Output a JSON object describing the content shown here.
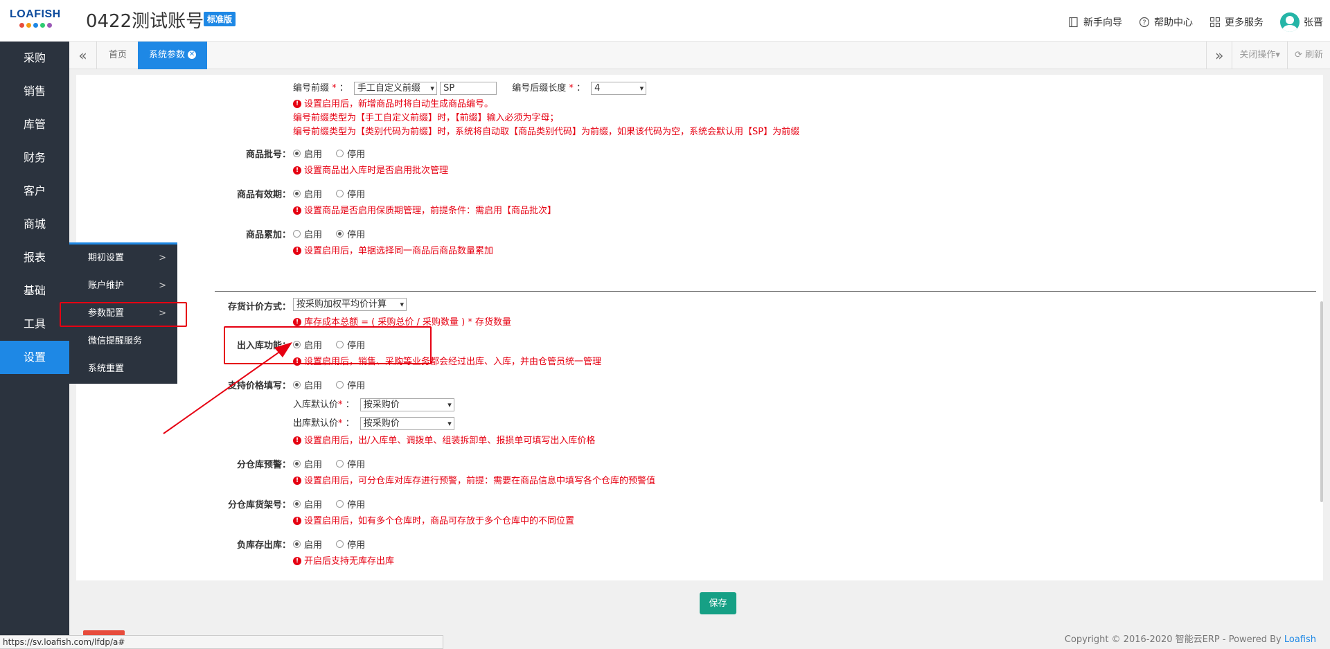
{
  "header": {
    "logo_text": "LOAFISH",
    "account_title": "0422测试账号",
    "edition": "标准版",
    "links": [
      {
        "label": "新手向导",
        "icon": "book-icon"
      },
      {
        "label": "帮助中心",
        "icon": "help-circle-icon"
      },
      {
        "label": "更多服务",
        "icon": "grid-icon"
      }
    ],
    "user_name": "张晋"
  },
  "sidebar": {
    "items": [
      "采购",
      "销售",
      "库管",
      "财务",
      "客户",
      "商城",
      "报表",
      "基础",
      "工具",
      "设置"
    ],
    "active_index": 9
  },
  "tabs": {
    "home": "首页",
    "active": "系统参数",
    "close_ops": "关闭操作",
    "refresh": "刷新"
  },
  "submenu": {
    "items": [
      {
        "label": "期初设置",
        "arrow": ">"
      },
      {
        "label": "账户维护",
        "arrow": ">"
      },
      {
        "label": "参数配置",
        "arrow": ">"
      },
      {
        "label": "微信提醒服务",
        "arrow": ""
      },
      {
        "label": "系统重置",
        "arrow": ""
      }
    ]
  },
  "form": {
    "prefix": {
      "label": "编号前缀",
      "type_value": "手工自定义前缀",
      "text_value": "SP",
      "suffix_label": "编号后缀长度",
      "suffix_value": "4",
      "hints": [
        "设置启用后，新增商品时将自动生成商品编号。",
        "编号前缀类型为【手工自定义前缀】时，【前缀】输入必须为字母；",
        "编号前缀类型为【类别代码为前缀】时，系统将自动取【商品类别代码】为前缀，如果该代码为空，系统会默认用【SP】为前缀"
      ]
    },
    "enable_label": "启用",
    "disable_label": "停用",
    "batch": {
      "label": "商品批号：",
      "hint": "设置商品出入库时是否启用批次管理",
      "enabled": true
    },
    "expiry": {
      "label": "商品有效期：",
      "hint": "设置商品是否启用保质期管理，前提条件：需启用【商品批次】",
      "enabled": true
    },
    "accumulate": {
      "label": "商品累加：",
      "hint": "设置启用后，单据选择同一商品后商品数量累加",
      "enabled": false
    },
    "valuation": {
      "label": "存货计价方式：",
      "value": "按采购加权平均价计算",
      "hint": "库存成本总额 = ( 采购总价 / 采购数量 ) * 存货数量"
    },
    "inout": {
      "label": "出入库功能：",
      "hint": "设置启用后，销售、采购等业务都会经过出库、入库，并由仓管员统一管理",
      "enabled": true
    },
    "price_fill": {
      "label": "支持价格填写：",
      "enabled": true,
      "in_label": "入库默认价",
      "in_value": "按采购价",
      "out_label": "出库默认价",
      "out_value": "按采购价",
      "hint": "设置启用后，出/入库单、调拨单、组装拆卸单、报损单可填写出入库价格"
    },
    "warehouse_alert": {
      "label": "分仓库预警：",
      "hint": "设置启用后，可分仓库对库存进行预警，前提：需要在商品信息中填写各个仓库的预警值",
      "enabled": true
    },
    "warehouse_shelf": {
      "label": "分仓库货架号：",
      "hint": "设置启用后，如有多个仓库时，商品可存放于多个仓库中的不同位置",
      "enabled": true
    },
    "negative_stock": {
      "label": "负库存出库：",
      "hint": "开启后支持无库存出库",
      "enabled": true
    }
  },
  "save_label": "保存",
  "footer": {
    "copyright": "Copyright © 2016-2020 智能云ERP - Powered By ",
    "brand": "Loafish",
    "status_url": "https://sv.loafish.com/lfdp/a#"
  },
  "colors": {
    "accent": "#1e88e5",
    "sidebar_bg": "#2b333e",
    "hint_red": "#e60012",
    "save_green": "#16a085"
  }
}
